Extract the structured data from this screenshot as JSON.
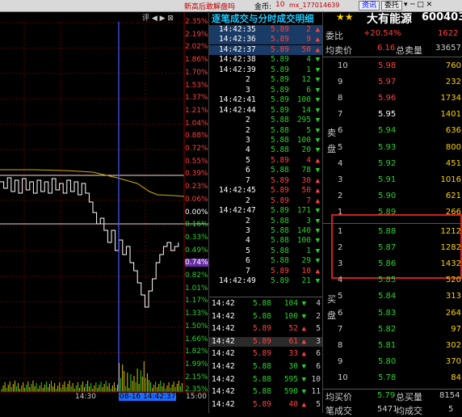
{
  "topbar": {
    "notice": "新高后敢解盘吗",
    "coin_label": "金币:",
    "coin_value": "10",
    "username": "mx_177014639",
    "news_button": "资讯",
    "order_button": "委托",
    "toolbar_text": "评 ◀ ▶ ⊠"
  },
  "chart": {
    "pct_labels": [
      {
        "text": "2.35%",
        "color": "red"
      },
      {
        "text": "2.19%",
        "color": "red"
      },
      {
        "text": "2.02%",
        "color": "red"
      },
      {
        "text": "1.86%",
        "color": "red"
      },
      {
        "text": "1.70%",
        "color": "red"
      },
      {
        "text": "1.53%",
        "color": "red"
      },
      {
        "text": "1.37%",
        "color": "red"
      },
      {
        "text": "1.21%",
        "color": "red"
      },
      {
        "text": "1.04%",
        "color": "red"
      },
      {
        "text": "0.88%",
        "color": "red"
      },
      {
        "text": "0.72%",
        "color": "red"
      },
      {
        "text": "0.55%",
        "color": "red"
      },
      {
        "text": "0.39%",
        "color": "red"
      },
      {
        "text": "0.23%",
        "color": "red"
      },
      {
        "text": "0.06%",
        "color": "red"
      },
      {
        "text": "0.00%",
        "color": "white"
      },
      {
        "text": "0.16%",
        "color": "green"
      },
      {
        "text": "0.33%",
        "color": "green"
      },
      {
        "text": "0.49%",
        "color": "green"
      },
      {
        "text": "0.74%",
        "color": "white"
      },
      {
        "text": "0.82%",
        "color": "green"
      },
      {
        "text": "1.01%",
        "color": "green"
      },
      {
        "text": "1.17%",
        "color": "green"
      },
      {
        "text": "1.33%",
        "color": "green"
      },
      {
        "text": "1.50%",
        "color": "green"
      },
      {
        "text": "1.66%",
        "color": "green"
      },
      {
        "text": "1.82%",
        "color": "green"
      },
      {
        "text": "1.99%",
        "color": "green"
      },
      {
        "text": "2.15%",
        "color": "green"
      },
      {
        "text": "2.35%",
        "color": "green"
      }
    ],
    "time_start": "14:30",
    "cursor_label": "08-16 14:42:37",
    "time_end": "15:00"
  },
  "middle": {
    "title": "逐笔成交与分时成交明细",
    "ticks": [
      {
        "time": "14:42:35",
        "price": "5.89",
        "vol": "2",
        "dir": "up",
        "hl": true
      },
      {
        "time": "14:42:36",
        "price": "5.89",
        "vol": "9",
        "dir": "up",
        "hl": true
      },
      {
        "time": "14:42:37",
        "price": "5.89",
        "vol": "50",
        "dir": "up",
        "hl": true
      },
      {
        "time": "14:42:38",
        "price": "5.89",
        "vol": "4",
        "dir": "down",
        "hl": false
      },
      {
        "time": "14:42:39",
        "price": "5.89",
        "vol": "1",
        "dir": "down",
        "hl": false
      },
      {
        "time": "2",
        "price": "5.89",
        "vol": "12",
        "dir": "down",
        "hl": false
      },
      {
        "time": "3",
        "price": "5.89",
        "vol": "6",
        "dir": "down",
        "hl": false
      },
      {
        "time": "14:42:41",
        "price": "5.89",
        "vol": "100",
        "dir": "down",
        "hl": false
      },
      {
        "time": "14:42:44",
        "price": "5.89",
        "vol": "14",
        "dir": "down",
        "hl": false
      },
      {
        "time": "2",
        "price": "5.88",
        "vol": "295",
        "dir": "down",
        "hl": false
      },
      {
        "time": "2",
        "price": "5.88",
        "vol": "5",
        "dir": "down",
        "hl": false
      },
      {
        "time": "3",
        "price": "5.88",
        "vol": "100",
        "dir": "down",
        "hl": false
      },
      {
        "time": "4",
        "price": "5.88",
        "vol": "20",
        "dir": "down",
        "hl": false
      },
      {
        "time": "5",
        "price": "5.89",
        "vol": "4",
        "dir": "up",
        "hl": false
      },
      {
        "time": "6",
        "price": "5.88",
        "vol": "78",
        "dir": "down",
        "hl": false
      },
      {
        "time": "7",
        "price": "5.89",
        "vol": "30",
        "dir": "up",
        "hl": false
      },
      {
        "time": "14:42:45",
        "price": "5.89",
        "vol": "50",
        "dir": "up",
        "hl": false
      },
      {
        "time": "2",
        "price": "5.89",
        "vol": "7",
        "dir": "up",
        "hl": false
      },
      {
        "time": "14:42:47",
        "price": "5.89",
        "vol": "171",
        "dir": "down",
        "hl": false
      },
      {
        "time": "2",
        "price": "5.88",
        "vol": "3",
        "dir": "down",
        "hl": false
      },
      {
        "time": "3",
        "price": "5.88",
        "vol": "140",
        "dir": "down",
        "hl": false
      },
      {
        "time": "4",
        "price": "5.88",
        "vol": "100",
        "dir": "down",
        "hl": false
      },
      {
        "time": "5",
        "price": "5.88",
        "vol": "1",
        "dir": "down",
        "hl": false
      },
      {
        "time": "6",
        "price": "5.88",
        "vol": "29",
        "dir": "down",
        "hl": false
      },
      {
        "time": "7",
        "price": "5.89",
        "vol": "10",
        "dir": "up",
        "hl": false
      },
      {
        "time": "14:42:49",
        "price": "5.89",
        "vol": "21",
        "dir": "down",
        "hl": false
      }
    ],
    "minute_rows": [
      {
        "time": "14:42",
        "price": "5.88",
        "vol": "104",
        "dir": "down",
        "n": "4"
      },
      {
        "time": "14:42",
        "price": "5.88",
        "vol": "100",
        "dir": "down",
        "n": "2"
      },
      {
        "time": "14:42",
        "price": "5.89",
        "vol": "52",
        "dir": "up",
        "n": "5"
      },
      {
        "time": "14:42",
        "price": "5.89",
        "vol": "61",
        "dir": "up",
        "n": "3"
      },
      {
        "time": "14:42",
        "price": "5.89",
        "vol": "33",
        "dir": "up",
        "n": "6"
      },
      {
        "time": "14:42",
        "price": "5.88",
        "vol": "30",
        "dir": "down",
        "n": "6"
      },
      {
        "time": "14:42",
        "price": "5.88",
        "vol": "595",
        "dir": "down",
        "n": "10"
      },
      {
        "time": "14:42",
        "price": "5.88",
        "vol": "590",
        "dir": "down",
        "n": "11"
      },
      {
        "time": "14:42",
        "price": "5.89",
        "vol": "40",
        "dir": "up",
        "n": "5"
      }
    ]
  },
  "right": {
    "stock_name": "大有能源",
    "stock_code": "600403",
    "weibi_label": "委比",
    "weibi_value": "+20.54%",
    "weibi_diff": "1622",
    "avg_sell_label": "均卖价",
    "avg_sell_value": "6.16",
    "total_sell_label": "总卖量",
    "total_sell_value": "33657",
    "sell_side_label_1": "卖",
    "sell_side_label_2": "盘",
    "buy_side_label_1": "买",
    "buy_side_label_2": "盘",
    "asks": [
      {
        "level": "10",
        "price": "5.98",
        "vol": "760",
        "color": "red"
      },
      {
        "level": "9",
        "price": "5.97",
        "vol": "232",
        "color": "red"
      },
      {
        "level": "8",
        "price": "5.96",
        "vol": "1734",
        "color": "red"
      },
      {
        "level": "7",
        "price": "5.95",
        "vol": "1401",
        "color": "white"
      },
      {
        "level": "6",
        "price": "5.94",
        "vol": "636",
        "color": "green"
      },
      {
        "level": "5",
        "price": "5.93",
        "vol": "800",
        "color": "green"
      },
      {
        "level": "4",
        "price": "5.92",
        "vol": "451",
        "color": "green"
      },
      {
        "level": "3",
        "price": "5.91",
        "vol": "1016",
        "color": "green"
      },
      {
        "level": "2",
        "price": "5.90",
        "vol": "621",
        "color": "green"
      },
      {
        "level": "1",
        "price": "5.89",
        "vol": "266",
        "color": "green"
      }
    ],
    "bids": [
      {
        "level": "1",
        "price": "5.88",
        "vol": "1212",
        "color": "green"
      },
      {
        "level": "2",
        "price": "5.87",
        "vol": "1282",
        "color": "green"
      },
      {
        "level": "3",
        "price": "5.86",
        "vol": "1432",
        "color": "green"
      },
      {
        "level": "4",
        "price": "5.85",
        "vol": "520",
        "color": "green"
      },
      {
        "level": "5",
        "price": "5.84",
        "vol": "313",
        "color": "green"
      },
      {
        "level": "6",
        "price": "5.83",
        "vol": "264",
        "color": "green"
      },
      {
        "level": "7",
        "price": "5.82",
        "vol": "97",
        "color": "green"
      },
      {
        "level": "8",
        "price": "5.81",
        "vol": "302",
        "color": "green"
      },
      {
        "level": "9",
        "price": "5.80",
        "vol": "370",
        "color": "green"
      },
      {
        "level": "10",
        "price": "5.78",
        "vol": "84",
        "color": "green"
      }
    ],
    "avg_buy_label": "均买价",
    "avg_buy_value": "5.79",
    "total_buy_label": "总买量",
    "total_buy_value": "8154",
    "trade_count_label": "笔成交",
    "trade_count_value": "5471",
    "avg_trade_label": "均成交",
    "avg_trade_value": "5"
  }
}
